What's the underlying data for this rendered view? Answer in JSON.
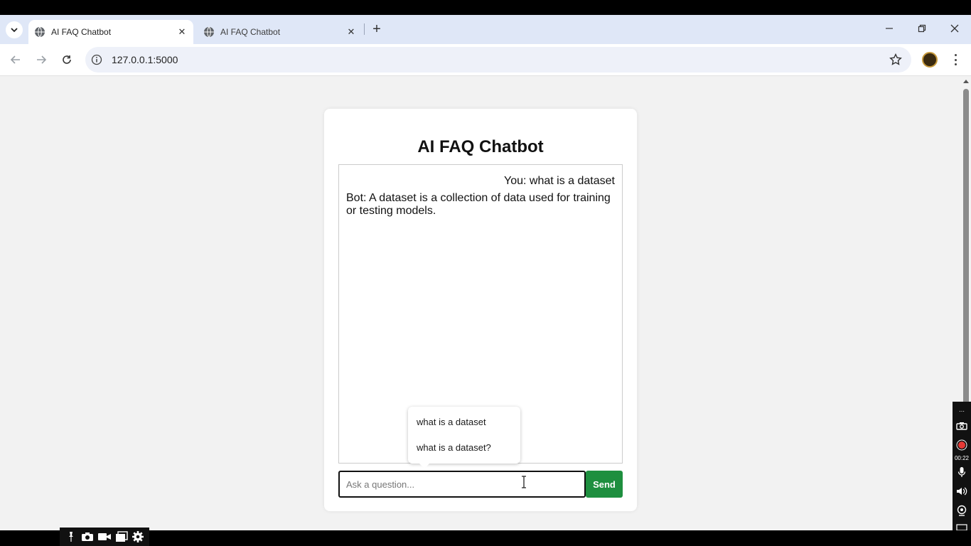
{
  "browser": {
    "tabs": [
      {
        "title": "AI FAQ Chatbot",
        "active": true
      },
      {
        "title": "AI FAQ Chatbot",
        "active": false
      }
    ],
    "url": "127.0.0.1:5000"
  },
  "page": {
    "title": "AI FAQ Chatbot",
    "messages": [
      {
        "role": "user",
        "text": "You: what is a dataset"
      },
      {
        "role": "bot",
        "text": "Bot: A dataset is a collection of data used for training or testing models."
      }
    ],
    "input": {
      "placeholder": "Ask a question...",
      "value": ""
    },
    "send_label": "Send",
    "autocomplete": [
      "what is a dataset",
      "what is a dataset?"
    ]
  },
  "recorder": {
    "timer": "00:22"
  },
  "colors": {
    "send_button": "#1e8f3f",
    "tabstrip": "#dfe7f7",
    "page_bg": "#f2f2f2"
  }
}
